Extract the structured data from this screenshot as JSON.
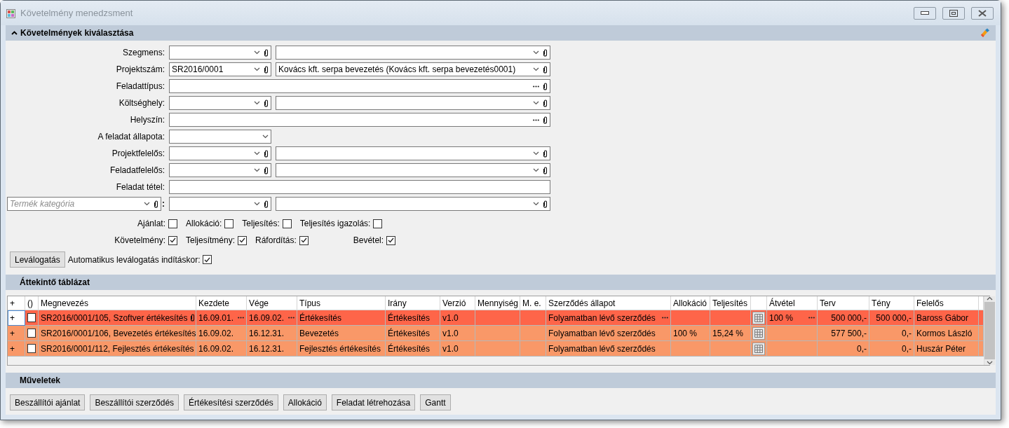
{
  "window": {
    "title": "Követelmény menedzsment"
  },
  "selection_panel": {
    "title": "Követelmények kiválasztása",
    "expanded": true,
    "fields": [
      {
        "kind": "combo_pair",
        "label": "Szegmens:"
      },
      {
        "kind": "combo_pair",
        "label": "Projektszám:",
        "value": "SR2016/0001",
        "detail": "Kovács kft. serpa bevezetés (Kovács kft. serpa bevezetés0001)"
      },
      {
        "kind": "lookup",
        "label": "Feladattípus:"
      },
      {
        "kind": "combo_pair",
        "label": "Költséghely:"
      },
      {
        "kind": "lookup",
        "label": "Helyszín:"
      },
      {
        "kind": "combo",
        "label": "A feladat állapota:"
      },
      {
        "kind": "combo_pair",
        "label": "Projektfelelős:"
      },
      {
        "kind": "combo_pair",
        "label": "Feladatfelelős:"
      },
      {
        "kind": "text",
        "label": "Feladat tétel:"
      },
      {
        "kind": "category_pair",
        "placeholder": "Termék kategória",
        "separator": ":"
      }
    ],
    "flags": [
      [
        {
          "label": "Ajánlat:",
          "checked": false
        },
        {
          "label": "Allokáció:",
          "checked": false
        },
        {
          "label": "Teljesítés:",
          "checked": false
        },
        {
          "label": "Teljesítés igazolás:",
          "checked": false
        }
      ],
      [
        {
          "label": "Követelmény:",
          "checked": true
        },
        {
          "label": "Teljesítmény:",
          "checked": true
        },
        {
          "label": "Ráfordítás:",
          "checked": true
        },
        {
          "label": "Bevétel:",
          "checked": true
        }
      ]
    ],
    "filter_button": "Leválogatás",
    "auto_filter": {
      "label": "Automatikus leválogatás indításkor:",
      "checked": true
    }
  },
  "overview": {
    "title": "Áttekintő táblázat",
    "columns": [
      {
        "kind": "text",
        "label": "+"
      },
      {
        "kind": "check",
        "label": "()"
      },
      {
        "kind": "text",
        "label": "Megnevezés",
        "attachment": true
      },
      {
        "kind": "text",
        "label": "Kezdete",
        "browse": true
      },
      {
        "kind": "text",
        "label": "Vége",
        "browse": true
      },
      {
        "kind": "text",
        "label": "Típus"
      },
      {
        "kind": "text",
        "label": "Irány"
      },
      {
        "kind": "text",
        "label": "Verzió"
      },
      {
        "kind": "text",
        "label": "Mennyiség"
      },
      {
        "kind": "text",
        "label": "M. e."
      },
      {
        "kind": "text",
        "label": "Szerződés állapot",
        "browse": true
      },
      {
        "kind": "text",
        "label": "Allokáció"
      },
      {
        "kind": "text",
        "label": "Teljesítés"
      },
      {
        "kind": "grid_button"
      },
      {
        "kind": "text",
        "label": "Átvétel",
        "browse": true
      },
      {
        "kind": "number",
        "label": "Terv"
      },
      {
        "kind": "number",
        "label": "Tény"
      },
      {
        "kind": "text",
        "label": "Felelős"
      }
    ],
    "rows": [
      {
        "selected": true,
        "checked": false,
        "cells": [
          "+",
          null,
          "SR2016/0001/105, Szoftver értékesítés",
          "16.09.01.",
          "16.09.02.",
          "Értékesítés",
          "Értékesítés",
          "v1.0",
          null,
          null,
          "Folyamatban lévő szerződés",
          null,
          null,
          null,
          "100 %",
          "500 000,-",
          "500 000,-",
          "Baross Gábor"
        ]
      },
      {
        "selected": false,
        "checked": false,
        "cells": [
          "+",
          null,
          "SR2016/0001/106, Bevezetés értékesítés",
          "16.09.02.",
          "16.12.31.",
          "Bevezetés",
          "Értékesítés",
          "v1.0",
          null,
          null,
          "Folyamatban lévő szerződés",
          "100 %",
          "15,24 %",
          null,
          null,
          "577 500,-",
          "0,-",
          "Kormos László"
        ]
      },
      {
        "selected": false,
        "checked": false,
        "cells": [
          "+",
          null,
          "SR2016/0001/112, Fejlesztés értékesítés",
          "16.09.02.",
          "16.12.31.",
          "Fejlesztés értékesítés",
          "Értékesítés",
          "v1.0",
          null,
          null,
          "Folyamatban lévő szerződés",
          null,
          null,
          null,
          null,
          "0,-",
          "0,-",
          "Huszár Péter"
        ]
      }
    ]
  },
  "operations": {
    "title": "Műveletek",
    "buttons": [
      "Beszállítói ajánlat",
      "Beszállítói szerződés",
      "Értékesítési szerződés",
      "Allokáció",
      "Feladat létrehozása",
      "Gantt"
    ]
  }
}
